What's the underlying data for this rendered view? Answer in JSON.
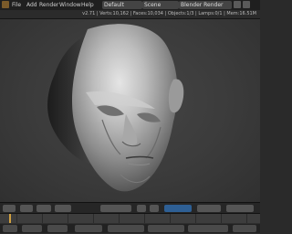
{
  "window": {
    "menu": [
      "File",
      "Add",
      "Render",
      "Window",
      "Help"
    ],
    "layout_label": "Default",
    "scene_label": "Scene",
    "engine_label": "Blender Render"
  },
  "info": {
    "stats": "v2.71 | Verts:10,162 | Faces:10,034 | Objects:1/3 | Lamps:0/1 | Mem:16.51M"
  },
  "viewport": {
    "object": "head sculpt (grey clay)"
  },
  "colors": {
    "bg": "#3a3a3a",
    "panel": "#262626",
    "accent": "#d0a040",
    "clay_light": "#bfbfbf",
    "clay_dark": "#4a4a4a"
  }
}
